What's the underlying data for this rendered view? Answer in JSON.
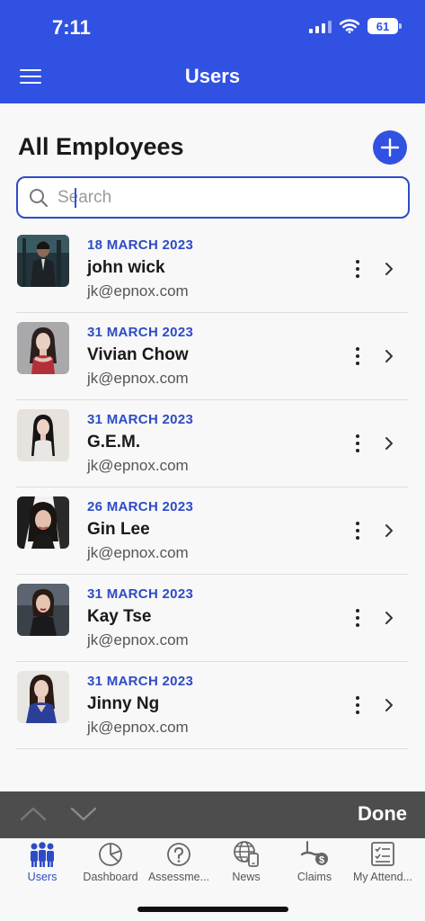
{
  "status": {
    "time": "7:11",
    "battery": "61"
  },
  "header": {
    "title": "Users"
  },
  "main": {
    "title": "All Employees",
    "search": {
      "placeholder": "Search",
      "value": ""
    }
  },
  "employees": [
    {
      "date": "18 MARCH 2023",
      "name": "john wick",
      "email": "jk@epnox.com"
    },
    {
      "date": "31 MARCH 2023",
      "name": "Vivian Chow",
      "email": "jk@epnox.com"
    },
    {
      "date": "31 MARCH 2023",
      "name": "G.E.M.",
      "email": "jk@epnox.com"
    },
    {
      "date": "26 MARCH 2023",
      "name": "Gin Lee",
      "email": "jk@epnox.com"
    },
    {
      "date": "31 MARCH 2023",
      "name": "Kay Tse",
      "email": "jk@epnox.com"
    },
    {
      "date": "31 MARCH 2023",
      "name": "Jinny Ng",
      "email": "jk@epnox.com"
    }
  ],
  "keyboard_bar": {
    "done_label": "Done"
  },
  "tabs": [
    {
      "label": "Users",
      "icon": "users-icon"
    },
    {
      "label": "Dashboard",
      "icon": "pie-chart-icon"
    },
    {
      "label": "Assessme...",
      "icon": "question-icon"
    },
    {
      "label": "News",
      "icon": "globe-phone-icon"
    },
    {
      "label": "Claims",
      "icon": "claims-dollar-icon"
    },
    {
      "label": "My Attend...",
      "icon": "checklist-icon"
    }
  ],
  "colors": {
    "primary": "#3151e3",
    "date_text": "#2e4bc7",
    "keyboard_bar": "#4d4d4d"
  }
}
